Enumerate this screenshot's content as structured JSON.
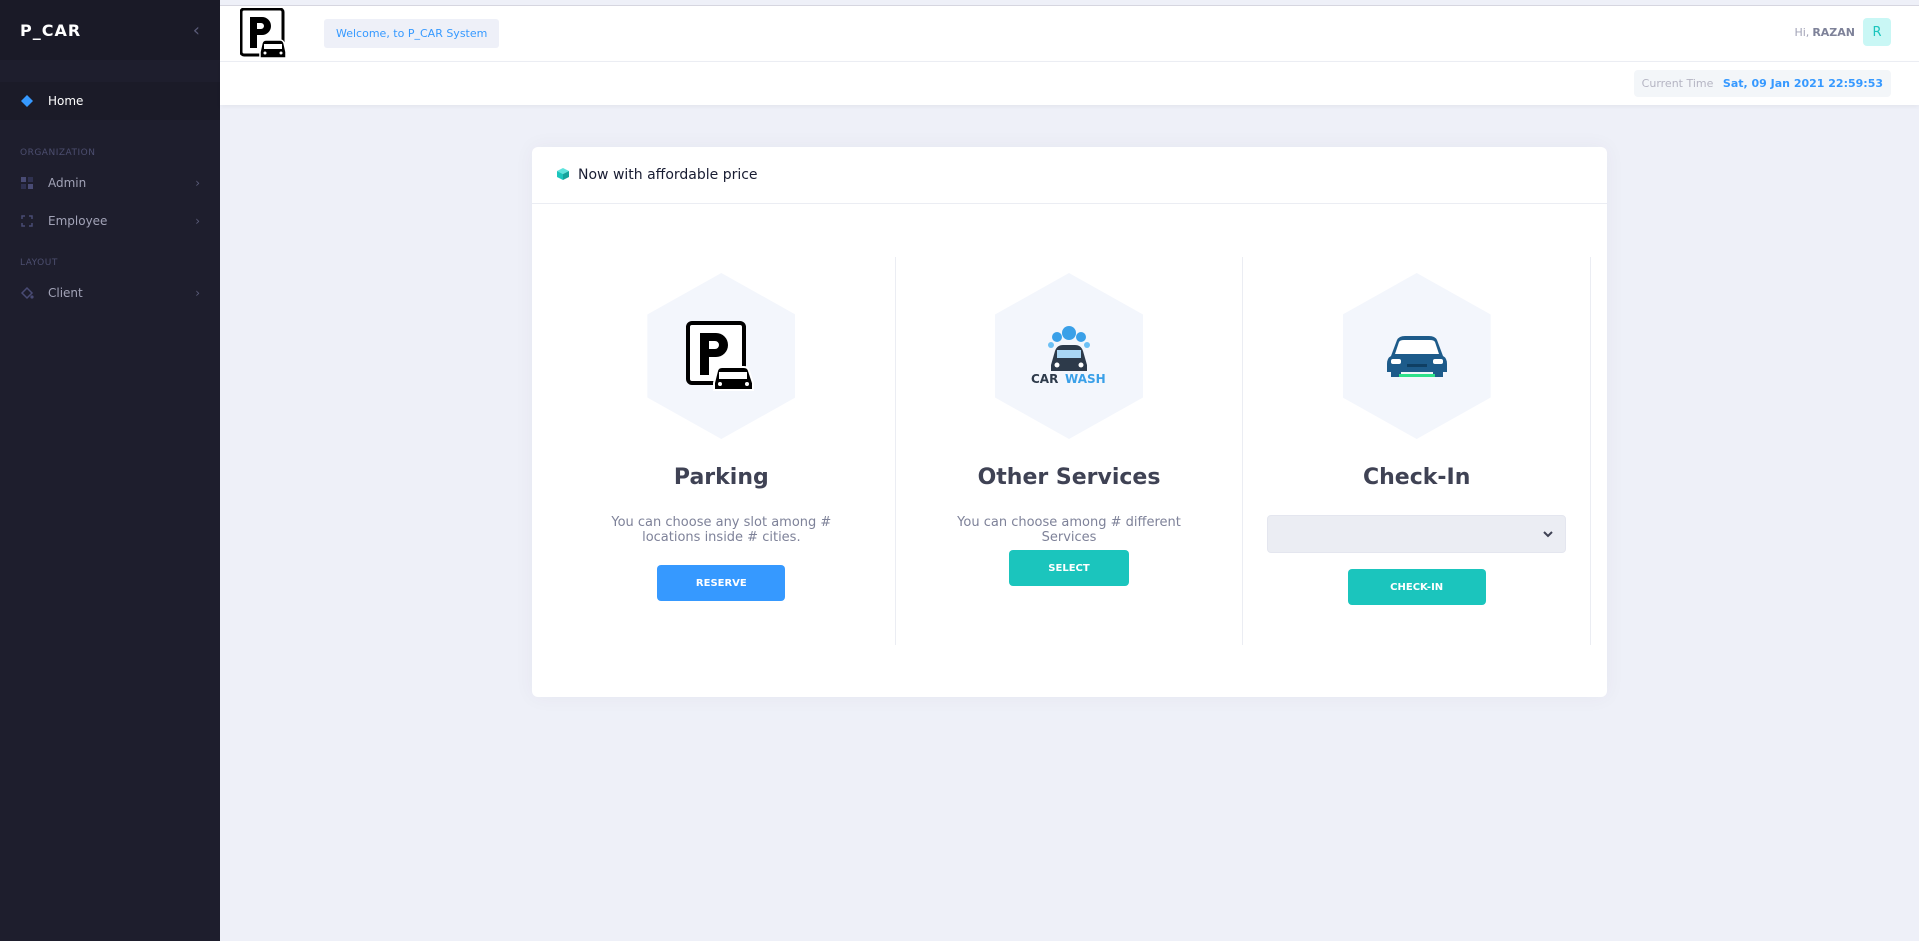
{
  "sidebar": {
    "brand": "P_CAR",
    "home": "Home",
    "section_org": "ORGANIZATION",
    "admin": "Admin",
    "employee": "Employee",
    "section_layout": "LAYOUT",
    "client": "Client"
  },
  "header": {
    "welcome": "Welcome, to P_CAR System",
    "greeting": "Hi,",
    "username": "RAZAN",
    "avatar_letter": "R"
  },
  "subheader": {
    "time_label": "Current Time",
    "time_value": "Sat, 09 Jan 2021 22:59:53"
  },
  "card": {
    "title": "Now with affordable price",
    "parking": {
      "title": "Parking",
      "desc": "You can choose any slot among # locations inside # cities.",
      "button": "RESERVE"
    },
    "services": {
      "title": "Other Services",
      "desc": "You can choose among # different Services",
      "button": "SELECT",
      "logo_text_car": "CAR",
      "logo_text_wash": "WASH"
    },
    "checkin": {
      "title": "Check-In",
      "select_value": "",
      "button": "CHECK-IN"
    }
  },
  "colors": {
    "primary": "#3699ff",
    "success": "#1bc5bd",
    "sidebar": "#1e1e2d"
  }
}
